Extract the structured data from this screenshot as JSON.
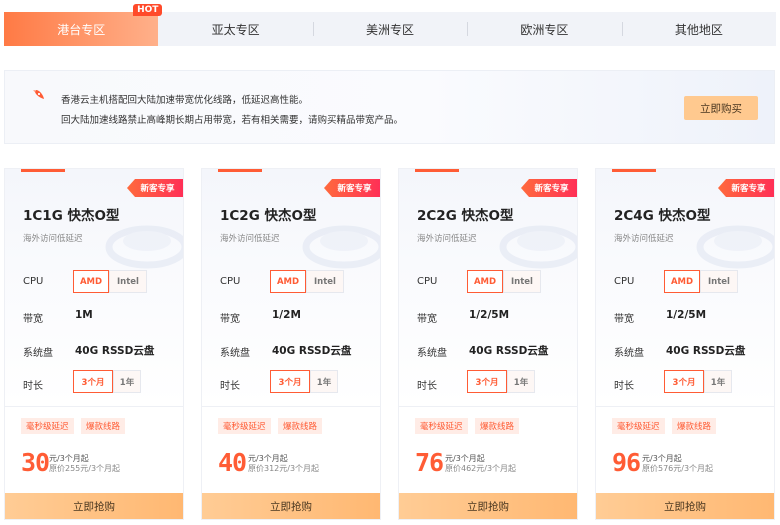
{
  "tabs": [
    {
      "label": "港台专区",
      "active": true,
      "badge": "HOT"
    },
    {
      "label": "亚太专区",
      "active": false
    },
    {
      "label": "美洲专区",
      "active": false
    },
    {
      "label": "欧洲专区",
      "active": false
    },
    {
      "label": "其他地区",
      "active": false
    }
  ],
  "notice": {
    "icon": "rocket-icon",
    "line1": "香港云主机搭配回大陆加速带宽优化线路，低延迟高性能。",
    "line2": "回大陆加速线路禁止高峰期长期占用带宽，若有相关需要，请购买精品带宽产品。",
    "button": "立即购买"
  },
  "labels": {
    "cpu": "CPU",
    "bandwidth": "带宽",
    "disk": "系统盘",
    "duration": "时长"
  },
  "colors": {
    "accent": "#ff5c35",
    "button": "#ffc98f",
    "tab_active": "#ff7a45"
  },
  "cards": [
    {
      "ribbon": "新客专享",
      "title": "1C1G 快杰O型",
      "subtitle": "海外访问低延迟",
      "cpu_options": [
        "AMD",
        "Intel"
      ],
      "cpu_selected": "AMD",
      "bandwidth": "1M",
      "disk": "40G RSSD云盘",
      "duration_options": [
        "3个月",
        "1年"
      ],
      "duration_selected": "3个月",
      "tags": [
        "毫秒级延迟",
        "爆款线路"
      ],
      "price": "30",
      "price_unit": "元/3个月起",
      "original_price": "原价255元/3个月起",
      "buy": "立即抢购"
    },
    {
      "ribbon": "新客专享",
      "title": "1C2G 快杰O型",
      "subtitle": "海外访问低延迟",
      "cpu_options": [
        "AMD",
        "Intel"
      ],
      "cpu_selected": "AMD",
      "bandwidth": "1/2M",
      "disk": "40G RSSD云盘",
      "duration_options": [
        "3个月",
        "1年"
      ],
      "duration_selected": "3个月",
      "tags": [
        "毫秒级延迟",
        "爆款线路"
      ],
      "price": "40",
      "price_unit": "元/3个月起",
      "original_price": "原价312元/3个月起",
      "buy": "立即抢购"
    },
    {
      "ribbon": "新客专享",
      "title": "2C2G 快杰O型",
      "subtitle": "海外访问低延迟",
      "cpu_options": [
        "AMD",
        "Intel"
      ],
      "cpu_selected": "AMD",
      "bandwidth": "1/2/5M",
      "disk": "40G RSSD云盘",
      "duration_options": [
        "3个月",
        "1年"
      ],
      "duration_selected": "3个月",
      "tags": [
        "毫秒级延迟",
        "爆款线路"
      ],
      "price": "76",
      "price_unit": "元/3个月起",
      "original_price": "原价462元/3个月起",
      "buy": "立即抢购"
    },
    {
      "ribbon": "新客专享",
      "title": "2C4G 快杰O型",
      "subtitle": "海外访问低延迟",
      "cpu_options": [
        "AMD",
        "Intel"
      ],
      "cpu_selected": "AMD",
      "bandwidth": "1/2/5M",
      "disk": "40G RSSD云盘",
      "duration_options": [
        "3个月",
        "1年"
      ],
      "duration_selected": "3个月",
      "tags": [
        "毫秒级延迟",
        "爆款线路"
      ],
      "price": "96",
      "price_unit": "元/3个月起",
      "original_price": "原价576元/3个月起",
      "buy": "立即抢购"
    }
  ]
}
